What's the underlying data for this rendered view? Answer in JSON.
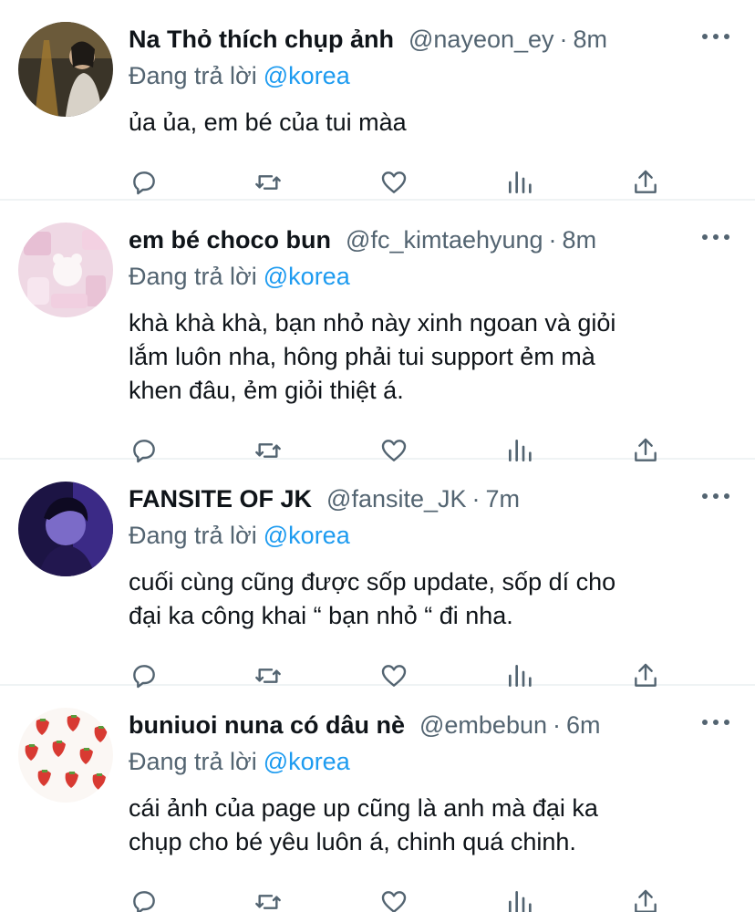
{
  "reply_prefix": "Đang trả lời",
  "tweets": [
    {
      "name": "Na Thỏ thích chụp ảnh",
      "handle": "@nayeon_ey",
      "dot": "·",
      "time": "8m",
      "reply_to": "@korea",
      "text": "ủa ủa, em bé của tui màa"
    },
    {
      "name": "em bé choco bun",
      "handle": "@fc_kimtaehyung",
      "dot": "·",
      "time": "8m",
      "reply_to": "@korea",
      "text": "khà khà khà, bạn nhỏ này xinh ngoan và giỏi\nlắm luôn nha, hông phải tui support ẻm mà\nkhen đâu, ẻm giỏi thiệt á."
    },
    {
      "name": "FANSITE OF JK",
      "handle": "@fansite_JK",
      "dot": "·",
      "time": "7m",
      "reply_to": "@korea",
      "text": "cuối cùng cũng được sốp update, sốp dí cho\nđại ka công khai “ bạn nhỏ “ đi nha."
    },
    {
      "name": "buniuoi nuna có dâu nè",
      "handle": "@embebun",
      "dot": "·",
      "time": "6m",
      "reply_to": "@korea",
      "text": "cái ảnh của page up cũng là anh mà đại ka\nchụp cho bé yêu luôn á, chinh quá chinh."
    }
  ],
  "icons": {
    "reply": "reply-icon",
    "retweet": "retweet-icon",
    "like": "like-icon",
    "stats": "stats-icon",
    "share": "share-icon",
    "more": "more-icon"
  },
  "colors": {
    "mention": "#1d9bf0",
    "secondary": "#536471",
    "text": "#0f1419",
    "divider": "#eff3f4"
  }
}
